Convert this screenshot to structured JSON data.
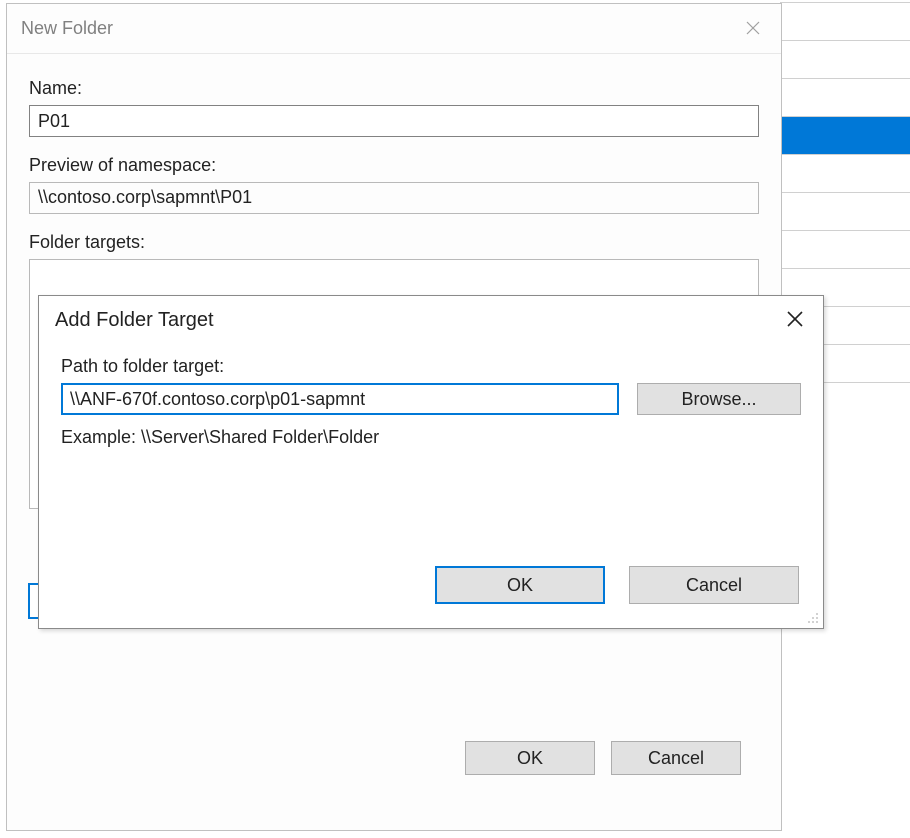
{
  "bg": {
    "row_positions": [
      2,
      40,
      78,
      116,
      154,
      192,
      230,
      268,
      306,
      344,
      382
    ],
    "selected_row_index": 3
  },
  "newfolder": {
    "title": "New Folder",
    "name_label": "Name:",
    "name_value": "P01",
    "preview_label": "Preview of namespace:",
    "preview_value": "\\\\contoso.corp\\sapmnt\\P01",
    "targets_label": "Folder targets:",
    "ok_label": "OK",
    "cancel_label": "Cancel"
  },
  "addtarget": {
    "title": "Add Folder Target",
    "path_label": "Path to folder target:",
    "path_value": "\\\\ANF-670f.contoso.corp\\p01-sapmnt",
    "browse_label": "Browse...",
    "example_label": "Example: \\\\Server\\Shared Folder\\Folder",
    "ok_label": "OK",
    "cancel_label": "Cancel"
  }
}
